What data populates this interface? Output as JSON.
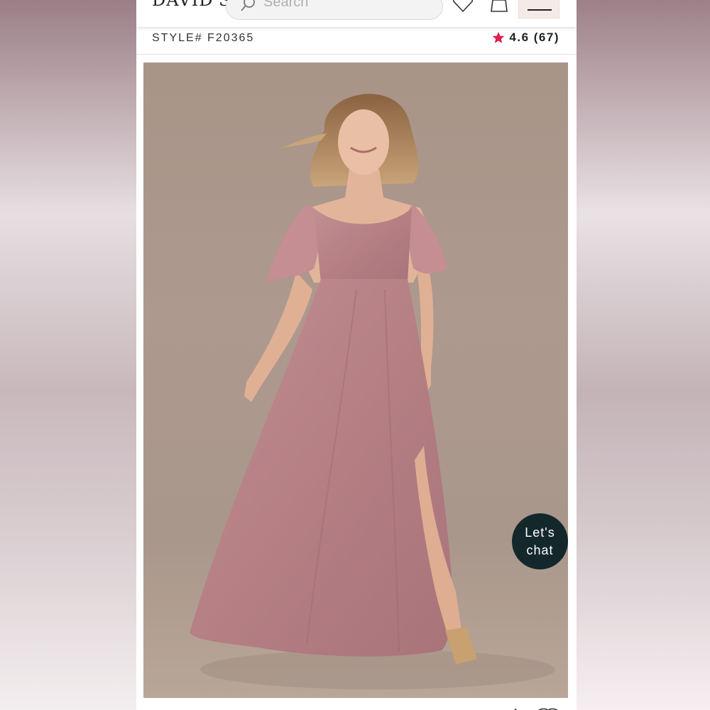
{
  "header": {
    "logo": "DAVID'S",
    "search_placeholder": "Search"
  },
  "product": {
    "style_number": "STYLE# F20365",
    "rating": "4.6 (67)"
  },
  "chat": {
    "label": "Let's chat"
  },
  "colors": {
    "star": "#e01e4a",
    "chat_bg": "#14282c",
    "dress": "#b98186",
    "menu_bg": "#f5ebe6"
  },
  "icons": [
    "search-icon",
    "heart-icon",
    "bag-icon",
    "hamburger-icon",
    "star-icon"
  ]
}
